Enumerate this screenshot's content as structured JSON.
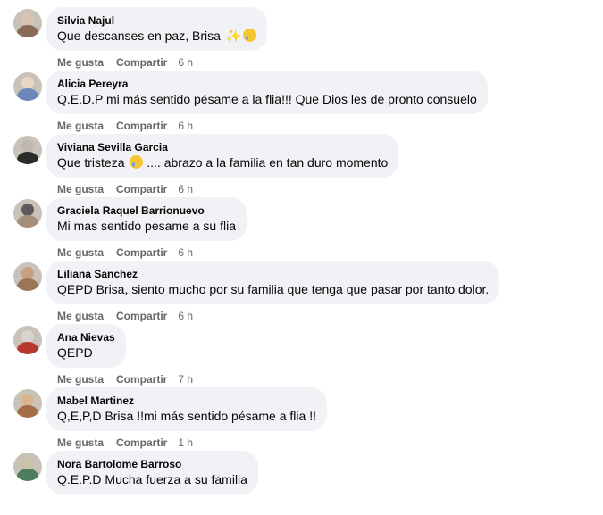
{
  "actions": {
    "like": "Me gusta",
    "share": "Compartir"
  },
  "comments": [
    {
      "author": "Silvia Najul",
      "text": "Que descanses en paz, Brisa",
      "emoji": [
        "sparkles",
        "sleepy-face"
      ],
      "time": "6 h",
      "avatar_colors": [
        "#8a6a55",
        "#d7c3b0"
      ]
    },
    {
      "author": "Alicia Pereyra",
      "text": "Q.E.D.P mi más sentido pésame a la flia!!! Que Dios les de pronto consuelo",
      "emoji": [],
      "time": "6 h",
      "avatar_colors": [
        "#6c88b8",
        "#e9d7c6"
      ]
    },
    {
      "author": "Viviana Sevilla Garcia",
      "text": "Que tristeza",
      "text_after": ".... abrazo a la familia en tan duro momento",
      "emoji": [
        "crying-face"
      ],
      "time": "6 h",
      "avatar_colors": [
        "#2b2b2b",
        "#bfb7ad"
      ]
    },
    {
      "author": "Graciela Raquel Barrionuevo",
      "text": "Mi mas sentido pesame a su flia",
      "emoji": [],
      "time": "6 h",
      "avatar_colors": [
        "#a58f7a",
        "#5b5b5b"
      ]
    },
    {
      "author": "Liliana Sanchez",
      "text": "QEPD Brisa, siento mucho por su familia que tenga que pasar por tanto dolor.",
      "emoji": [],
      "time": "6 h",
      "avatar_colors": [
        "#9c7456",
        "#c9a07f"
      ]
    },
    {
      "author": "Ana Nievas",
      "text": "QEPD",
      "emoji": [],
      "time": "7 h",
      "avatar_colors": [
        "#b8372f",
        "#d9d4cf"
      ]
    },
    {
      "author": "Mabel Martinez",
      "text": "Q,E,P,D Brisa !!mi más sentido pésame a flia !!",
      "emoji": [],
      "time": "1 h",
      "avatar_colors": [
        "#a56d45",
        "#d9b48c"
      ]
    },
    {
      "author": "Nora Bartolome Barroso",
      "text": "Q.E.P.D Mucha fuerza a su familia",
      "emoji": [],
      "time": "",
      "avatar_colors": [
        "#4d7d5c",
        "#c8c2a8"
      ]
    }
  ]
}
